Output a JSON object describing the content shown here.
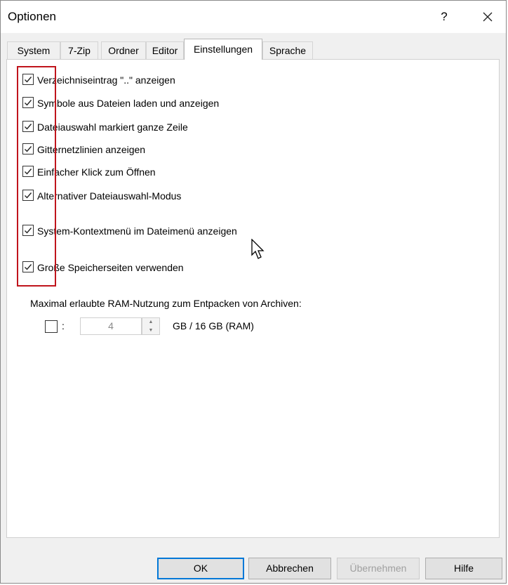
{
  "window": {
    "title": "Optionen",
    "help_label": "?"
  },
  "tabs": [
    {
      "label": "System"
    },
    {
      "label": "7-Zip"
    },
    {
      "label": "Ordner"
    },
    {
      "label": "Editor"
    },
    {
      "label": "Einstellungen",
      "active": true
    },
    {
      "label": "Sprache"
    }
  ],
  "settings": [
    {
      "label": "Verzeichniseintrag \"..\" anzeigen",
      "checked": true
    },
    {
      "label": "Symbole aus Dateien laden und anzeigen",
      "checked": true
    },
    {
      "label": "Dateiauswahl markiert ganze Zeile",
      "checked": true
    },
    {
      "label": "Gitternetzlinien anzeigen",
      "checked": true
    },
    {
      "label": "Einfacher Klick zum Öffnen",
      "checked": true
    },
    {
      "label": "Alternativer Dateiauswahl-Modus",
      "checked": true
    },
    {
      "label": "System-Kontextmenü im Dateimenü anzeigen",
      "checked": true
    },
    {
      "label": "Große Speicherseiten verwenden",
      "checked": true
    }
  ],
  "ram": {
    "label": "Maximal erlaubte RAM-Nutzung zum Entpacken von Archiven:",
    "checked": false,
    "colon": ":",
    "value": "4",
    "unit": "GB / 16 GB (RAM)"
  },
  "buttons": {
    "ok": "OK",
    "cancel": "Abbrechen",
    "apply": "Übernehmen",
    "help": "Hilfe"
  },
  "colors": {
    "highlight": "#c0141c",
    "default_button_border": "#0078d7"
  }
}
